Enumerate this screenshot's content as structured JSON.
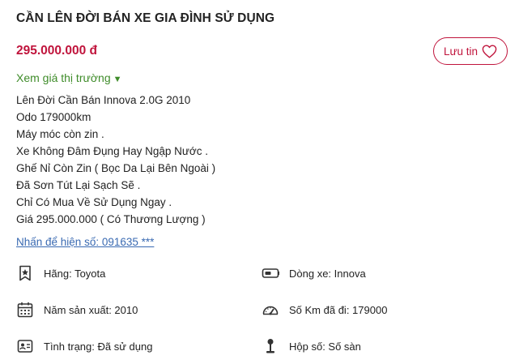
{
  "listing": {
    "title": "CẦN LÊN ĐỜI BÁN XE GIA ĐÌNH SỬ DỤNG",
    "price": "295.000.000 đ",
    "save_label": "Lưu tin",
    "market_price_link": "Xem giá thị trường",
    "description_lines": [
      "Lên Đời Cần Bán Innova 2.0G 2010",
      "Odo 179000km",
      "Máy móc còn zin .",
      "Xe Không Đâm Đụng Hay Ngập Nước .",
      "Ghế Nỉ Còn Zin ( Bọc Da Lại Bên Ngoài )",
      "Đã Sơn Tút Lại Sạch Sẽ .",
      "Chỉ Có Mua Về Sử Dụng Ngay .",
      "Giá 295.000.000 ( Có Thương Lượng )"
    ],
    "phone_reveal": "Nhấn để hiện số: 091635 ***"
  },
  "specs": {
    "brand": {
      "icon": "star-tag-icon",
      "text": "Hãng: Toyota"
    },
    "model": {
      "icon": "car-key-icon",
      "text": "Dòng xe: Innova"
    },
    "year": {
      "icon": "calendar-icon",
      "text": "Năm sản xuất: 2010"
    },
    "odometer": {
      "icon": "speedometer-icon",
      "text": "Số Km đã đi: 179000"
    },
    "condition": {
      "icon": "condition-card-icon",
      "text": "Tình trạng: Đã sử dụng"
    },
    "gearbox": {
      "icon": "gear-stick-icon",
      "text": "Hộp số: Số sàn"
    }
  },
  "colors": {
    "price": "#c0143c",
    "market_link": "#3f8c2a",
    "phone_link": "#3a6ab2"
  }
}
